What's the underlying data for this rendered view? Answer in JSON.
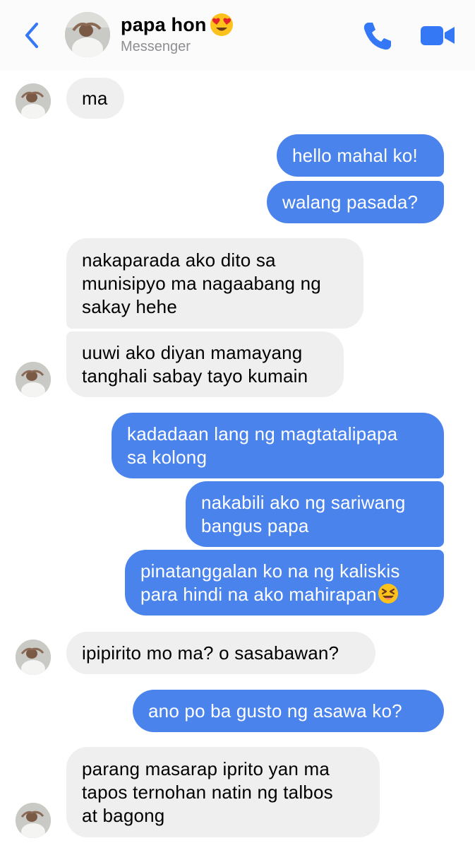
{
  "header": {
    "contact_name": "papa hon",
    "subtitle": "Messenger",
    "name_emoji": "heart-eyes-emoji",
    "back_icon": "chevron-left-icon",
    "call_icon": "phone-icon",
    "video_icon": "video-camera-icon",
    "accent_color": "#3478f6"
  },
  "colors": {
    "outgoing_bubble": "#4a83ec",
    "incoming_bubble": "#efefef"
  },
  "messages": [
    {
      "from": "contact",
      "lines": [
        "ma"
      ]
    },
    {
      "from": "me",
      "lines": [
        "hello mahal ko!"
      ]
    },
    {
      "from": "me",
      "lines": [
        "walang pasada?"
      ]
    },
    {
      "from": "contact",
      "lines": [
        "nakaparada ako dito sa",
        "munisipyo ma nagaabang ng",
        "sakay hehe"
      ]
    },
    {
      "from": "contact",
      "lines": [
        "uuwi ako diyan mamayang",
        "tanghali sabay tayo kumain"
      ]
    },
    {
      "from": "me",
      "lines": [
        "kadadaan lang ng magtatalipapa",
        "sa kolong"
      ]
    },
    {
      "from": "me",
      "lines": [
        "nakabili ako ng sariwang",
        "bangus papa"
      ]
    },
    {
      "from": "me",
      "lines": [
        "pinatanggalan ko na ng kaliskis",
        "para hindi na ako mahirapan"
      ],
      "trailing_emoji": "grinning-squinting-emoji"
    },
    {
      "from": "contact",
      "lines": [
        "ipipirito mo ma? o sasabawan?"
      ]
    },
    {
      "from": "me",
      "lines": [
        "ano po ba gusto ng asawa ko?"
      ]
    },
    {
      "from": "contact",
      "lines": [
        "parang masarap iprito yan ma",
        "tapos ternohan natin ng talbos",
        "at bagong"
      ]
    }
  ]
}
